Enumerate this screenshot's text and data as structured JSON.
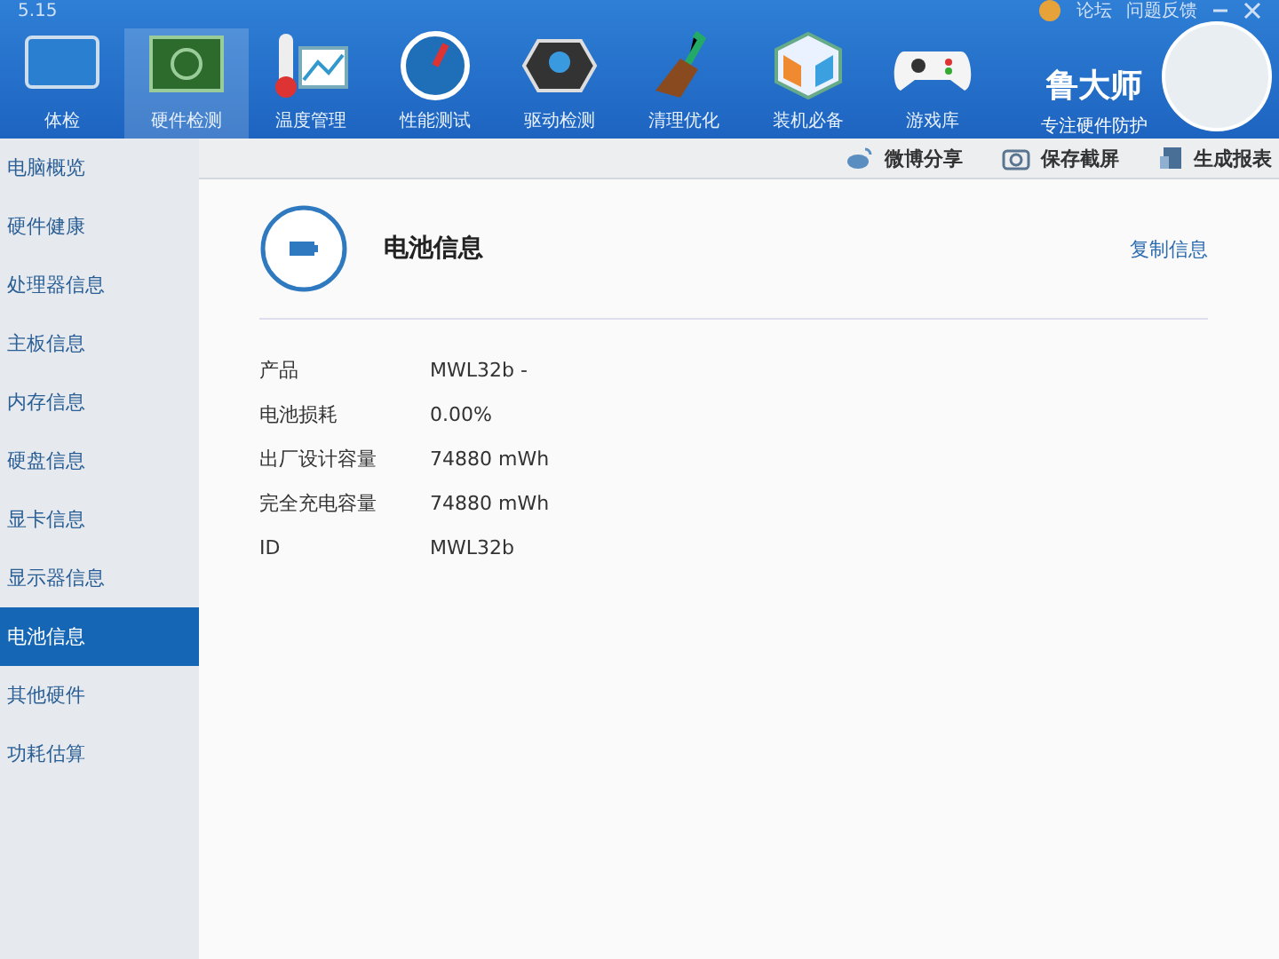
{
  "window": {
    "version": "5.15",
    "links": [
      "论坛",
      "问题反馈"
    ]
  },
  "nav": [
    {
      "label": "体检",
      "selected": false
    },
    {
      "label": "硬件检测",
      "selected": true
    },
    {
      "label": "温度管理",
      "selected": false
    },
    {
      "label": "性能测试",
      "selected": false
    },
    {
      "label": "驱动检测",
      "selected": false
    },
    {
      "label": "清理优化",
      "selected": false
    },
    {
      "label": "装机必备",
      "selected": false
    },
    {
      "label": "游戏库",
      "selected": false
    }
  ],
  "brand": {
    "name": "鲁大师",
    "slogan": "专注硬件防护"
  },
  "sidebar": {
    "items": [
      {
        "label": "电脑概览",
        "selected": false
      },
      {
        "label": "硬件健康",
        "selected": false
      },
      {
        "label": "处理器信息",
        "selected": false
      },
      {
        "label": "主板信息",
        "selected": false
      },
      {
        "label": "内存信息",
        "selected": false
      },
      {
        "label": "硬盘信息",
        "selected": false
      },
      {
        "label": "显卡信息",
        "selected": false
      },
      {
        "label": "显示器信息",
        "selected": false
      },
      {
        "label": "电池信息",
        "selected": true
      },
      {
        "label": "其他硬件",
        "selected": false
      },
      {
        "label": "功耗估算",
        "selected": false
      }
    ]
  },
  "toolbar": [
    {
      "label": "微博分享"
    },
    {
      "label": "保存截屏"
    },
    {
      "label": "生成报表"
    }
  ],
  "panel": {
    "title": "电池信息",
    "action": "复制信息",
    "rows": [
      {
        "label": "产品",
        "value": "MWL32b -"
      },
      {
        "label": "电池损耗",
        "value": "0.00%"
      },
      {
        "label": "出厂设计容量",
        "value": "74880 mWh"
      },
      {
        "label": "完全充电容量",
        "value": "74880 mWh"
      },
      {
        "label": "ID",
        "value": "MWL32b"
      }
    ]
  }
}
